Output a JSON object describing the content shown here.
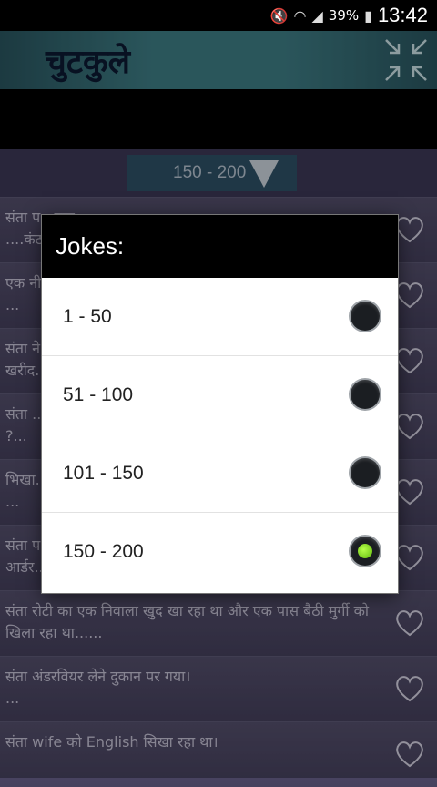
{
  "status_bar": {
    "battery": "39%",
    "time": "13:42"
  },
  "app_bar": {
    "title": "चुटकुले"
  },
  "selector": {
    "value": "150 - 200"
  },
  "jokes": [
    {
      "text": "संता प...बात...\n....कंठ..."
    },
    {
      "text": "एक नी...\n..."
    },
    {
      "text": "संता ने...\nखरीद..."
    },
    {
      "text": "संता ...\n?..."
    },
    {
      "text": "भिखा...\n..."
    },
    {
      "text": "संता प...\nआर्डर..."
    },
    {
      "text": "संता रोटी का एक निवाला खुद खा रहा था और एक पास बैठी मुर्गी को खिला रहा था......"
    },
    {
      "text": "संता अंडरवियर लेने दुकान पर गया।\n..."
    },
    {
      "text": "संता wife को English सिखा रहा था।"
    }
  ],
  "dialog": {
    "title": "Jokes:",
    "options": [
      {
        "label": "1 - 50",
        "selected": false
      },
      {
        "label": "51 - 100",
        "selected": false
      },
      {
        "label": "101 - 150",
        "selected": false
      },
      {
        "label": "150 - 200",
        "selected": true
      }
    ]
  },
  "colors": {
    "accent_radio": "#7ed321",
    "app_bar": "#3f7f87",
    "list_bg": "#4a4560"
  }
}
